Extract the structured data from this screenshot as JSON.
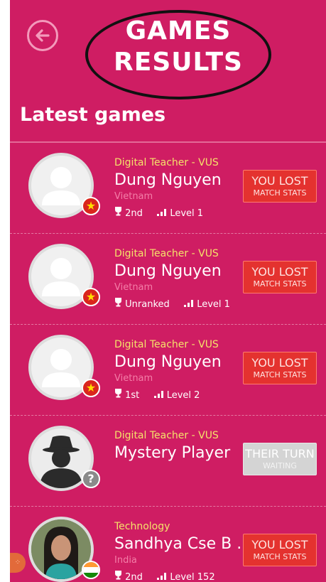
{
  "header": {
    "title_line1": "GAMES",
    "title_line2": "RESULTS",
    "section_title": "Latest games"
  },
  "games": [
    {
      "category": "Digital Teacher - VUS",
      "player": "Dung Nguyen",
      "country": "Vietnam",
      "rank": "2nd",
      "level": "Level 1",
      "status": "YOU LOST",
      "action": "MATCH STATS"
    },
    {
      "category": "Digital Teacher - VUS",
      "player": "Dung Nguyen",
      "country": "Vietnam",
      "rank": "Unranked",
      "level": "Level 1",
      "status": "YOU LOST",
      "action": "MATCH STATS"
    },
    {
      "category": "Digital Teacher - VUS",
      "player": "Dung Nguyen",
      "country": "Vietnam",
      "rank": "1st",
      "level": "Level 2",
      "status": "YOU LOST",
      "action": "MATCH STATS"
    },
    {
      "category": "Digital Teacher - VUS",
      "player": "Mystery Player",
      "country": "",
      "rank": "",
      "level": "",
      "status": "THEIR TURN",
      "action": "WAITING"
    },
    {
      "category": "Technology",
      "player": "Sandhya Cse B ...",
      "country": "India",
      "rank": "2nd",
      "level": "Level 152",
      "status": "YOU LOST",
      "action": "MATCH STATS"
    }
  ],
  "colors": {
    "background": "#cf1d63",
    "lost_button": "#e4322f",
    "waiting_button": "#d4d4d4",
    "category_text": "#f5e26a",
    "country_text": "#f47ea8"
  },
  "icons": {
    "back": "arrow-left-circle-icon",
    "rank": "trophy-icon",
    "level": "signal-bars-icon",
    "vietnam_badge": "star-flag-icon",
    "unknown_badge": "question-mark-icon"
  }
}
